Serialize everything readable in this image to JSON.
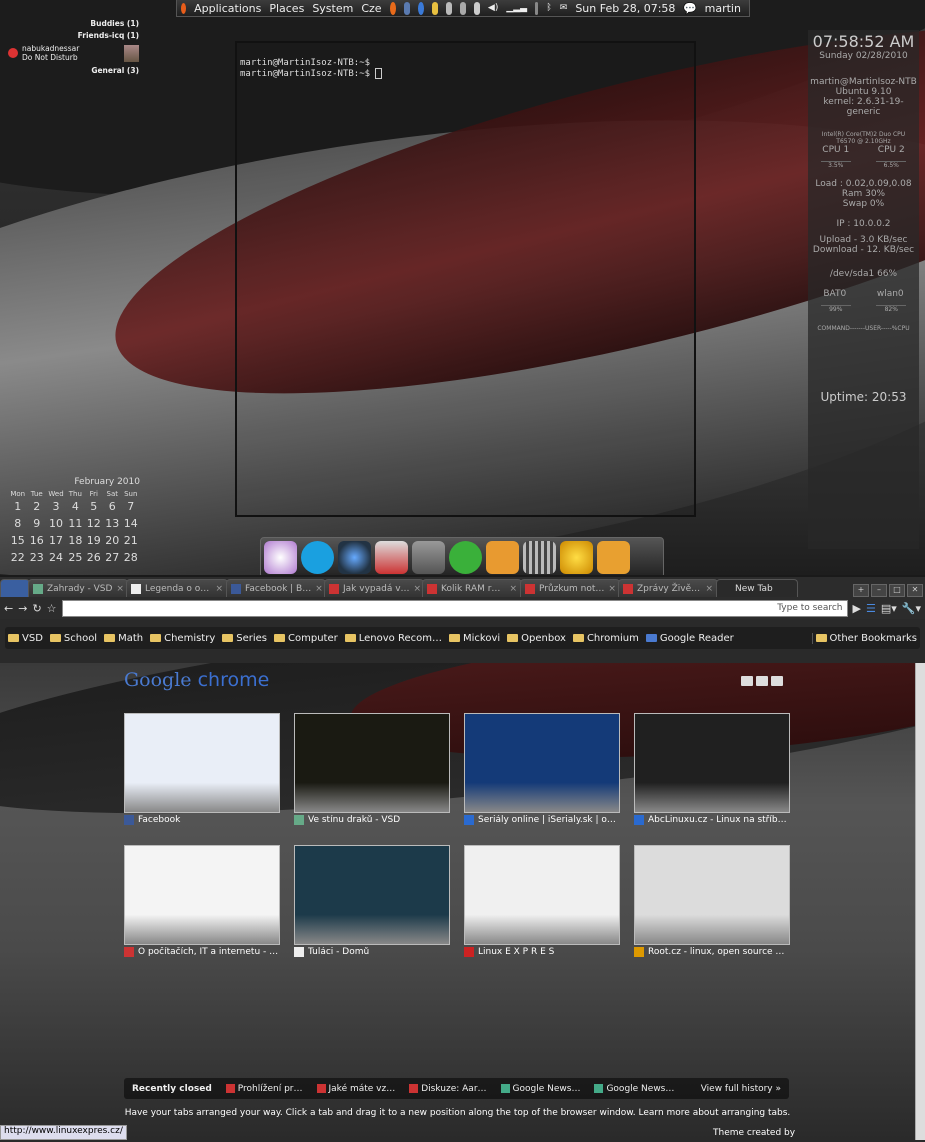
{
  "panel": {
    "applications": "Applications",
    "places": "Places",
    "system": "System",
    "lang": "Cze",
    "datetime": "Sun Feb 28, 07:58",
    "user": "martin"
  },
  "pidgin": {
    "buddies": "Buddies (1)",
    "friends": "Friends-icq (1)",
    "account_name": "nabukadnessar",
    "account_status": "Do Not Disturb",
    "general": "General (3)"
  },
  "terminal": {
    "line1": "martin@MartinIsoz-NTB:~$",
    "line2": "martin@MartinIsoz-NTB:~$"
  },
  "conky": {
    "time": "07:58:52 AM",
    "date": "Sunday 02/28/2010",
    "host": "martin@MartinIsoz-NTB",
    "os": "Ubuntu 9.10",
    "kernel": "kernel: 2.6.31-19-generic",
    "cpu_model": "Intel(R) Core(TM)2 Duo CPU",
    "cpu_speed": "T6570  @ 2.10GHz",
    "cpu1": "CPU 1",
    "cpu2": "CPU 2",
    "cpu1_val": "3.5%",
    "cpu2_val": "6.5%",
    "load": "Load : 0.02,0.09,0.08",
    "ram": "Ram 30%",
    "swap": "Swap 0%",
    "ip": "IP : 10.0.0.2",
    "upload": "Upload - 3.0 KB/sec",
    "download": "Download - 12. KB/sec",
    "disk": "/dev/sda1 66%",
    "bat_label": "BAT0",
    "wlan_label": "wlan0",
    "bat_val": "99%",
    "wlan_val": "82%",
    "proc_header": "COMMAND-------USER-----%CPU",
    "uptime": "Uptime: 20:53"
  },
  "calendar": {
    "title": "February 2010",
    "days": [
      "Mon",
      "Tue",
      "Wed",
      "Thu",
      "Fri",
      "Sat",
      "Sun"
    ],
    "weeks": [
      [
        "1",
        "2",
        "3",
        "4",
        "5",
        "6",
        "7"
      ],
      [
        "8",
        "9",
        "10",
        "11",
        "12",
        "13",
        "14"
      ],
      [
        "15",
        "16",
        "17",
        "18",
        "19",
        "20",
        "21"
      ],
      [
        "22",
        "23",
        "24",
        "25",
        "26",
        "27",
        "28"
      ]
    ]
  },
  "tabs": [
    {
      "label": "Zahrady - VSD",
      "color": "#6a8"
    },
    {
      "label": "Legenda o o…",
      "color": "#eee"
    },
    {
      "label": "Facebook | B…",
      "color": "#3b5998"
    },
    {
      "label": "Jak vypadá v…",
      "color": "#c33"
    },
    {
      "label": "Kolik RAM r…",
      "color": "#c33"
    },
    {
      "label": "Průzkum not…",
      "color": "#c33"
    },
    {
      "label": "Zprávy Živě…",
      "color": "#c33"
    },
    {
      "label": "New Tab",
      "color": "#2a2a2a"
    }
  ],
  "omnibox": {
    "placeholder": "Type to search"
  },
  "bookmarks": [
    "VSD",
    "School",
    "Math",
    "Chemistry",
    "Series",
    "Computer",
    "Lenovo Recom…",
    "Mickovi",
    "Openbox",
    "Chromium"
  ],
  "bookmark_reader": "Google Reader",
  "bookmark_other": "Other Bookmarks",
  "ntp": {
    "logo_google": "Google",
    "logo_chrome": "chrome",
    "thumbs": [
      {
        "label": "Facebook",
        "fav": "#3b5998",
        "bg": "#e9eef7"
      },
      {
        "label": "Ve stínu draků - VSD",
        "fav": "#6a8",
        "bg": "#1a1a12"
      },
      {
        "label": "Seriály online | iSerialy.sk | o…",
        "fav": "#2a6ad0",
        "bg": "#143a78"
      },
      {
        "label": "AbcLinuxu.cz - Linux na stříb…",
        "fav": "#2a6ad0",
        "bg": "#202020"
      },
      {
        "label": "O počítačích, IT a internetu - …",
        "fav": "#c33",
        "bg": "#f4f4f4"
      },
      {
        "label": "Tuláci - Domů",
        "fav": "#eee",
        "bg": "#1c3a4a"
      },
      {
        "label": "Linux E X P R E S",
        "fav": "#c22",
        "bg": "#f0f0f0"
      },
      {
        "label": "Root.cz - linux, open source …",
        "fav": "#d90",
        "bg": "#dcdcdc"
      }
    ],
    "recently_closed": "Recently closed",
    "recent": [
      {
        "label": "Prohlížení pr…",
        "fav": "#c33"
      },
      {
        "label": "Jaké máte vz…",
        "fav": "#c33"
      },
      {
        "label": "Diskuze: Aar…",
        "fav": "#c33"
      },
      {
        "label": "Google News…",
        "fav": "#4a8"
      },
      {
        "label": "Google News…",
        "fav": "#4a8"
      }
    ],
    "full_history": "View full history »",
    "hint": "Have your tabs arranged your way. Click a tab and drag it to a new position along the top of the browser window. Learn more about arranging tabs.",
    "theme_credit": "Theme created by"
  },
  "status_url": "http://www.linuxexpres.cz/"
}
